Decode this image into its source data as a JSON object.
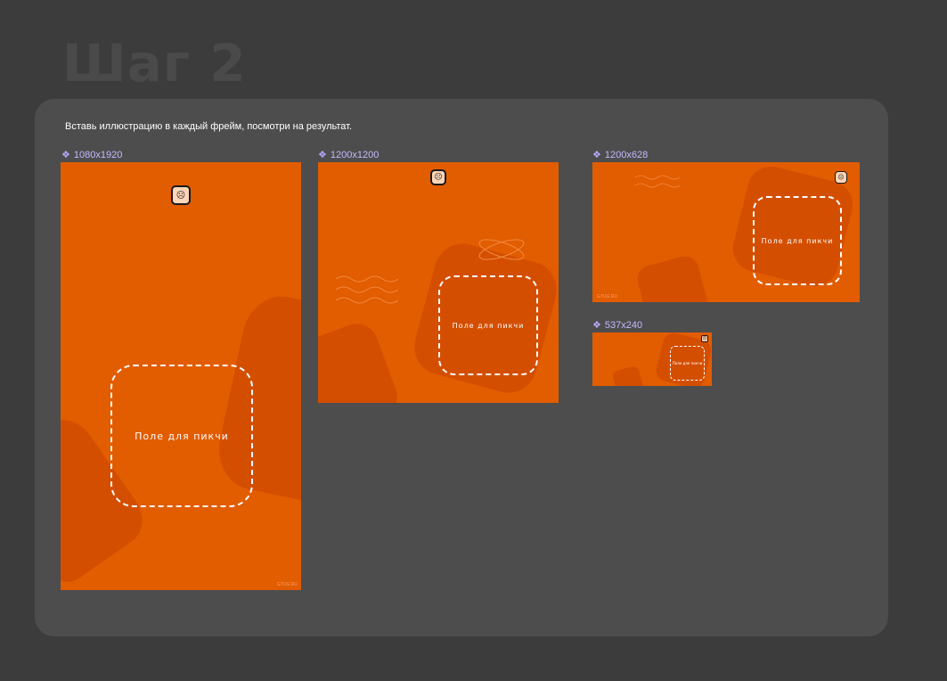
{
  "page": {
    "title": "Шаг 2",
    "instruction": "Вставь иллюстрацию в каждый фрейм, посмотри на результат."
  },
  "frames": [
    {
      "label": "1080x1920",
      "placeholder": "Поле для пикчи",
      "site": "GTUG.RU"
    },
    {
      "label": "1200x1200",
      "placeholder": "Поле для пикчи"
    },
    {
      "label": "1200x628",
      "placeholder": "Поле для пикчи",
      "site": "GTUG.RU"
    },
    {
      "label": "537x240",
      "placeholder": "Поле для пикчи"
    }
  ],
  "icons": {
    "component": "component-icon",
    "logo": "mascot-logo-icon"
  },
  "colors": {
    "background": "#3c3c3c",
    "panel": "#4d4d4d",
    "frame": "#e25c00",
    "shape": "#d44e00",
    "label": "#c6b8ff"
  }
}
